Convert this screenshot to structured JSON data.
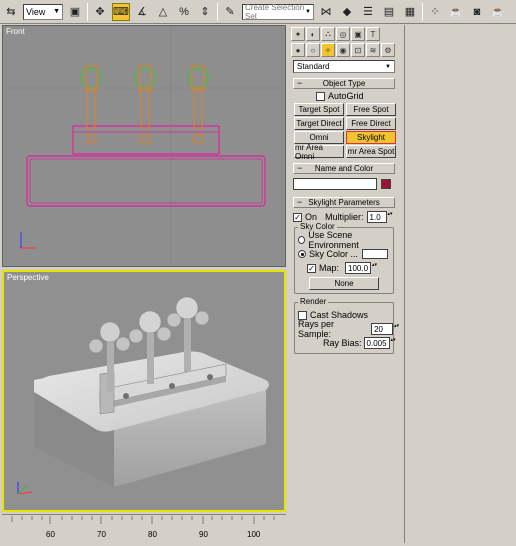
{
  "toolbar": {
    "view_select": "View",
    "selection_set_placeholder": "Create Selection Set"
  },
  "viewports": {
    "front_label": "Front",
    "perspective_label": "Perspective"
  },
  "ruler": {
    "ticks": [
      "60",
      "70",
      "80",
      "90",
      "100"
    ]
  },
  "command_panel": {
    "category_dropdown": "Standard",
    "object_type": {
      "title": "Object Type",
      "autogrid_label": "AutoGrid",
      "buttons": [
        "Target Spot",
        "Free Spot",
        "Target Direct",
        "Free Direct",
        "Omni",
        "Skylight",
        "mr Area Omni",
        "mr Area Spot"
      ],
      "active_button": "Skylight"
    },
    "name_and_color": {
      "title": "Name and Color",
      "name_value": "",
      "color": "#a0103a"
    },
    "skylight_params": {
      "title": "Skylight Parameters",
      "on_label": "On",
      "multiplier_label": "Multiplier:",
      "multiplier_value": "1.0",
      "sky_color_group": "Sky Color",
      "use_scene_env_label": "Use Scene Environment",
      "sky_color_label": "Sky Color ...",
      "map_label": "Map:",
      "map_value": "100.0",
      "map_button": "None",
      "render_group": "Render",
      "cast_shadows_label": "Cast Shadows",
      "rays_label": "Rays per Sample:",
      "rays_value": "20",
      "ray_bias_label": "Ray Bias:",
      "ray_bias_value": "0.005"
    }
  }
}
